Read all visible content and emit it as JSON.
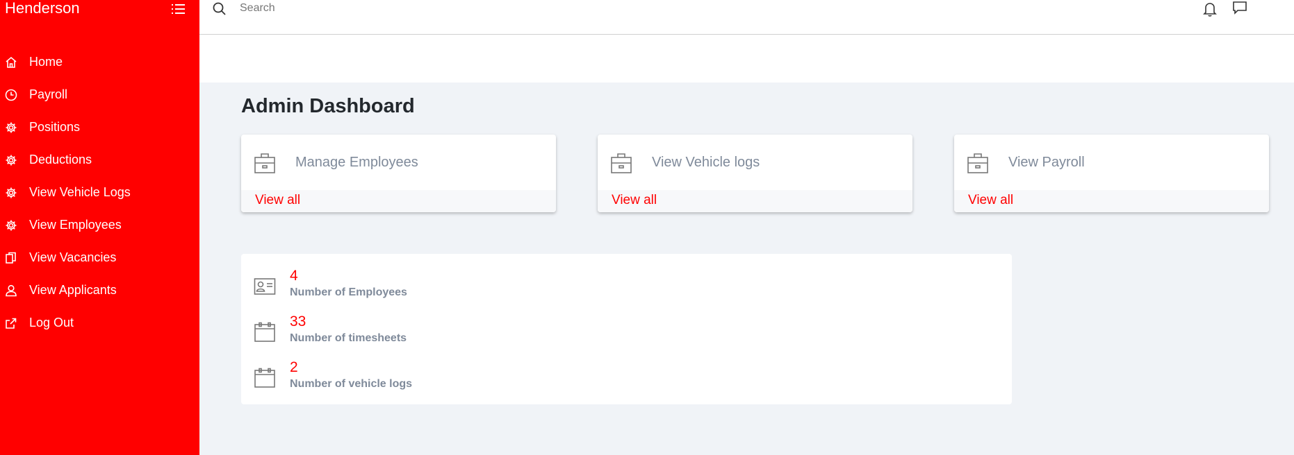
{
  "app": {
    "brand": "Henderson"
  },
  "sidebar": {
    "items": [
      {
        "label": "Home",
        "icon": "home-icon"
      },
      {
        "label": "Payroll",
        "icon": "clock-icon"
      },
      {
        "label": "Positions",
        "icon": "gear-icon"
      },
      {
        "label": "Deductions",
        "icon": "gear-icon"
      },
      {
        "label": "View Vehicle Logs",
        "icon": "gear-icon"
      },
      {
        "label": "View Employees",
        "icon": "gear-icon"
      },
      {
        "label": "View Vacancies",
        "icon": "copy-icon"
      },
      {
        "label": "View Applicants",
        "icon": "user-icon"
      },
      {
        "label": "Log Out",
        "icon": "logout-icon"
      }
    ]
  },
  "topbar": {
    "search_placeholder": "Search"
  },
  "main": {
    "title": "Admin Dashboard",
    "cards": [
      {
        "title": "Manage Employees",
        "link": "View all",
        "icon": "briefcase-icon"
      },
      {
        "title": "View Vehicle logs",
        "link": "View all",
        "icon": "briefcase-icon"
      },
      {
        "title": "View Payroll",
        "link": "View all",
        "icon": "briefcase-icon"
      }
    ],
    "stats": [
      {
        "value": "4",
        "label": "Number of Employees",
        "icon": "id-card-icon"
      },
      {
        "value": "33",
        "label": "Number of timesheets",
        "icon": "calendar-icon"
      },
      {
        "value": "2",
        "label": "Number of vehicle logs",
        "icon": "calendar-icon"
      }
    ]
  },
  "colors": {
    "accent": "#ff0000",
    "muted": "#7f8a9a",
    "background": "#f0f3f7"
  }
}
